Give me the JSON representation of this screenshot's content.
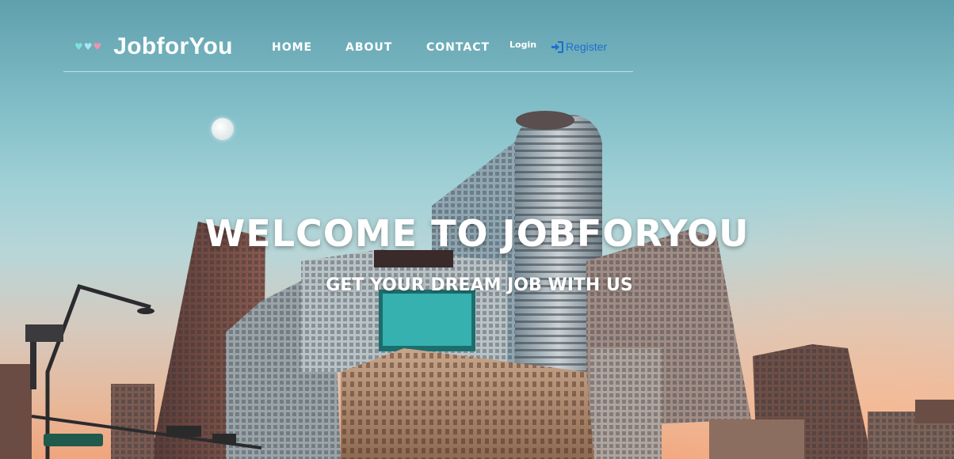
{
  "brand": {
    "name": "JobforYou",
    "heart_colors": [
      "#7fe0d8",
      "#a8e6f0",
      "#f48fb1"
    ]
  },
  "nav": {
    "home": "HOME",
    "about": "ABOUT",
    "contact": "CONTACT",
    "login": "Login",
    "register": "Register"
  },
  "hero": {
    "title": "WELCOME TO JOBFORYOU",
    "subtitle": "GET YOUR DREAM JOB WITH US"
  },
  "colors": {
    "register_link": "#1e6fd0",
    "text": "#ffffff"
  },
  "icons": {
    "register": "sign-in-icon"
  }
}
